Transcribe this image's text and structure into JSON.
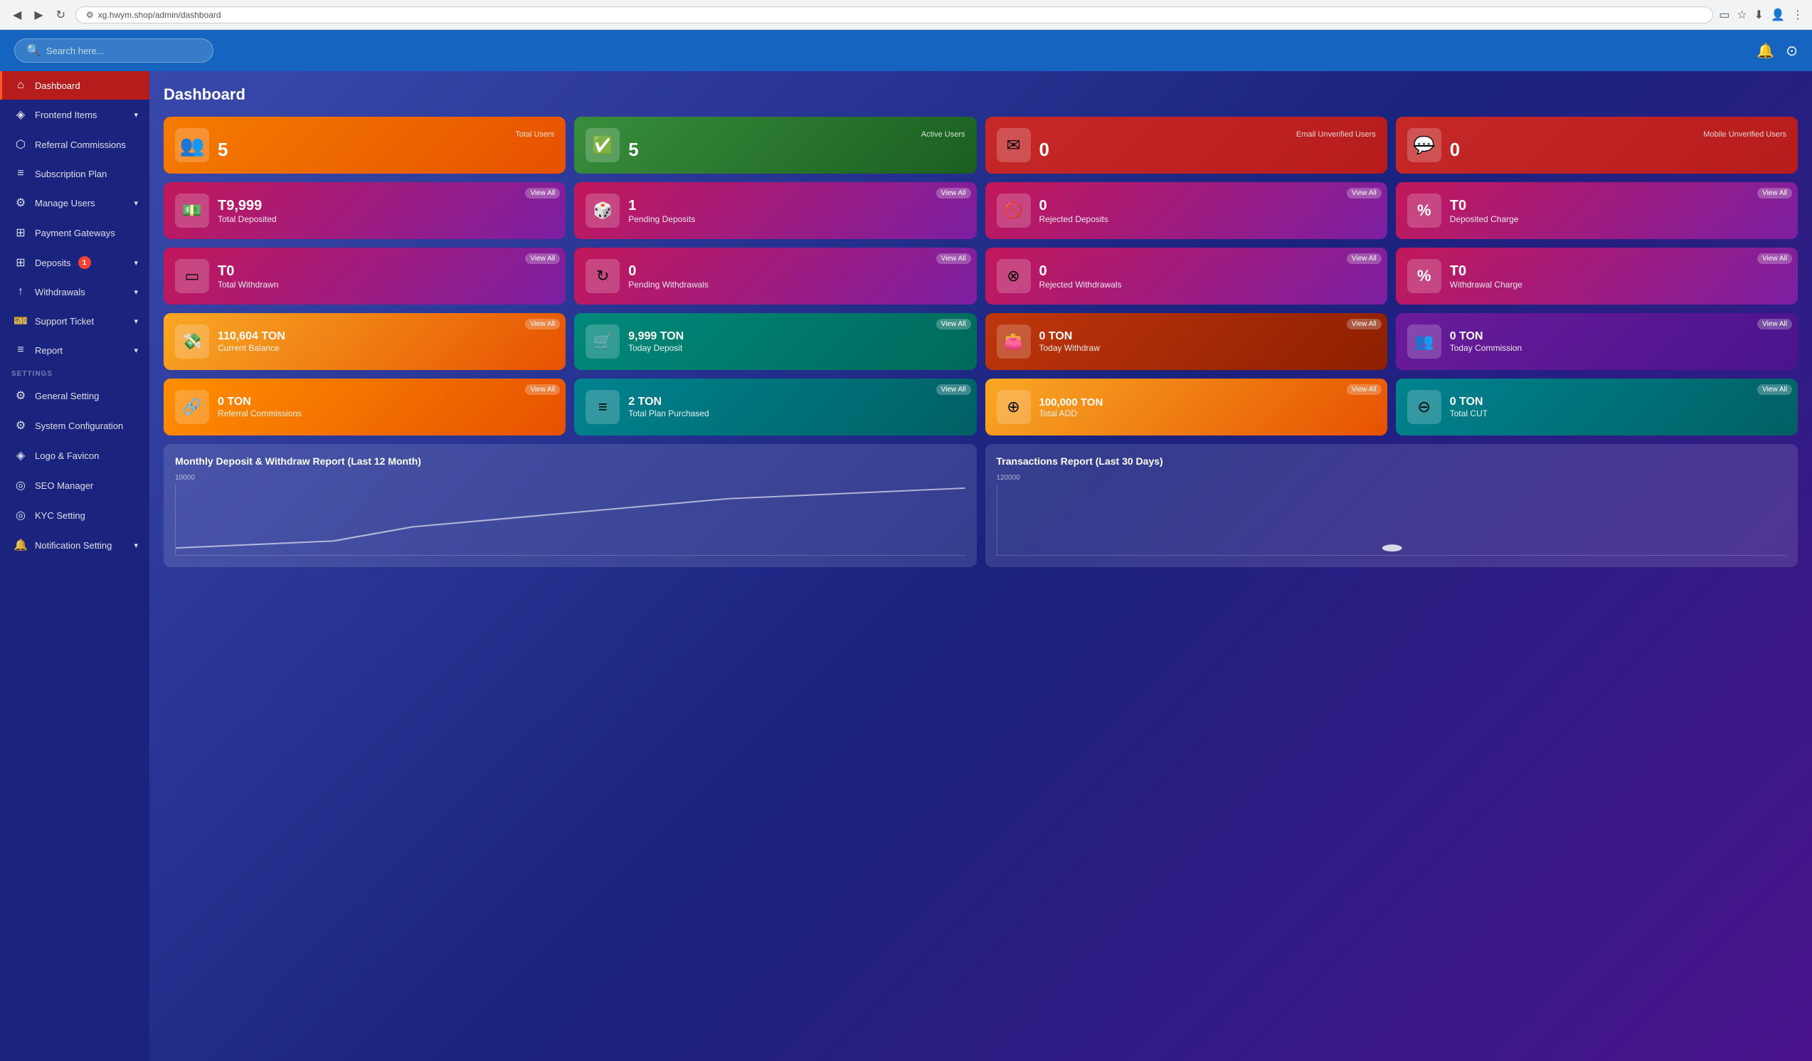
{
  "browser": {
    "url": "xg.hwym.shop/admin/dashboard",
    "back_icon": "◀",
    "forward_icon": "▶",
    "refresh_icon": "↻"
  },
  "header": {
    "search_placeholder": "Search here...",
    "bell_icon": "🔔",
    "settings_icon": "⚙"
  },
  "sidebar": {
    "items": [
      {
        "id": "dashboard",
        "label": "Dashboard",
        "icon": "⌂",
        "active": true
      },
      {
        "id": "frontend-items",
        "label": "Frontend Items",
        "icon": "◈",
        "has_arrow": true
      },
      {
        "id": "referral-commissions",
        "label": "Referral Commissions",
        "icon": "⬡",
        "has_arrow": false
      },
      {
        "id": "subscription-plan",
        "label": "Subscription Plan",
        "icon": "≡",
        "has_arrow": false
      },
      {
        "id": "manage-users",
        "label": "Manage Users",
        "icon": "⚙",
        "has_arrow": true
      },
      {
        "id": "payment-gateways",
        "label": "Payment Gateways",
        "icon": "⊞",
        "has_arrow": false
      },
      {
        "id": "deposits",
        "label": "Deposits",
        "icon": "⊞",
        "badge": "1",
        "has_arrow": true
      },
      {
        "id": "withdrawals",
        "label": "Withdrawals",
        "icon": "↑",
        "has_arrow": true
      },
      {
        "id": "support-ticket",
        "label": "Support Ticket",
        "icon": "🎫",
        "has_arrow": true
      },
      {
        "id": "report",
        "label": "Report",
        "icon": "≡",
        "has_arrow": true
      }
    ],
    "settings_section": "SETTINGS",
    "settings_items": [
      {
        "id": "general-setting",
        "label": "General Setting",
        "icon": "⚙"
      },
      {
        "id": "system-configuration",
        "label": "System Configuration",
        "icon": "⚙"
      },
      {
        "id": "logo-favicon",
        "label": "Logo & Favicon",
        "icon": "◈"
      },
      {
        "id": "seo-manager",
        "label": "SEO Manager",
        "icon": "◎"
      },
      {
        "id": "kyc-setting",
        "label": "KYC Setting",
        "icon": "◎"
      },
      {
        "id": "notification-setting",
        "label": "Notification Setting",
        "icon": "🔔",
        "has_arrow": true
      }
    ]
  },
  "page_title": "Dashboard",
  "stats_row1": [
    {
      "id": "total-users",
      "label": "Total Users",
      "value": "5",
      "name": "",
      "color": "card-orange",
      "icon": "👥",
      "view_all": false
    },
    {
      "id": "active-users",
      "label": "Active Users",
      "value": "5",
      "name": "",
      "color": "card-green",
      "icon": "✅",
      "view_all": false
    },
    {
      "id": "email-unverified",
      "label": "Email Unverified Users",
      "value": "0",
      "name": "",
      "color": "card-red",
      "icon": "✉",
      "view_all": false
    },
    {
      "id": "mobile-unverified",
      "label": "Mobile Unverified Users",
      "value": "0",
      "name": "",
      "color": "card-red",
      "icon": "💬",
      "view_all": false
    }
  ],
  "stats_row2": [
    {
      "id": "total-deposited",
      "label": "View All",
      "value": "T9,999",
      "name": "Total Deposited",
      "color": "card-pink-red",
      "icon": "💵",
      "view_all": true
    },
    {
      "id": "pending-deposits",
      "label": "View All",
      "value": "1",
      "name": "Pending Deposits",
      "color": "card-pink-red",
      "icon": "🎲",
      "view_all": true
    },
    {
      "id": "rejected-deposits",
      "label": "View All",
      "value": "0",
      "name": "Rejected Deposits",
      "color": "card-pink-red",
      "icon": "🚫",
      "view_all": true
    },
    {
      "id": "deposited-charge",
      "label": "View All",
      "value": "T0",
      "name": "Deposited Charge",
      "color": "card-pink-red",
      "icon": "%",
      "view_all": true
    }
  ],
  "stats_row3": [
    {
      "id": "total-withdrawn",
      "label": "View All",
      "value": "T0",
      "name": "Total Withdrawn",
      "color": "card-pink-red",
      "icon": "▭",
      "view_all": true
    },
    {
      "id": "pending-withdrawals",
      "label": "View All",
      "value": "0",
      "name": "Pending Withdrawals",
      "color": "card-pink-red",
      "icon": "↻",
      "view_all": true
    },
    {
      "id": "rejected-withdrawals",
      "label": "View All",
      "value": "0",
      "name": "Rejected Withdrawals",
      "color": "card-pink-red",
      "icon": "⊗",
      "view_all": true
    },
    {
      "id": "withdrawal-charge",
      "label": "View All",
      "value": "T0",
      "name": "Withdrawal Charge",
      "color": "card-pink-red",
      "icon": "%",
      "view_all": true
    }
  ],
  "stats_row4": [
    {
      "id": "current-balance",
      "label": "View All",
      "value": "110,604 TON",
      "name": "Current Balance",
      "color": "card-gold",
      "icon": "💸",
      "view_all": true
    },
    {
      "id": "today-deposit",
      "label": "View All",
      "value": "9,999 TON",
      "name": "Today Deposit",
      "color": "card-dark-teal",
      "icon": "🛒",
      "view_all": true
    },
    {
      "id": "today-withdraw",
      "label": "View All",
      "value": "0 TON",
      "name": "Today Withdraw",
      "color": "card-deep-orange",
      "icon": "👛",
      "view_all": true
    },
    {
      "id": "today-commission",
      "label": "View All",
      "value": "0 TON",
      "name": "Today Commission",
      "color": "card-purple",
      "icon": "👥",
      "view_all": true
    }
  ],
  "stats_row5": [
    {
      "id": "referral-commissions",
      "label": "View All",
      "value": "0 TON",
      "name": "Referral Commissions",
      "color": "card-amber",
      "icon": "🔗",
      "view_all": true
    },
    {
      "id": "total-plan-purchased",
      "label": "View All",
      "value": "2 TON",
      "name": "Total Plan Purchased",
      "color": "card-blue-green",
      "icon": "≡",
      "view_all": true
    },
    {
      "id": "total-add",
      "label": "View All",
      "value": "100,000 TON",
      "name": "Total ADD",
      "color": "card-gold",
      "icon": "⊕",
      "view_all": true
    },
    {
      "id": "total-cut",
      "label": "View All",
      "value": "0 TON",
      "name": "Total CUT",
      "color": "card-blue-green",
      "icon": "⊖",
      "view_all": true
    }
  ],
  "charts": [
    {
      "id": "monthly-report",
      "title": "Monthly Deposit & Withdraw Report (Last 12 Month)",
      "y_label": "10000"
    },
    {
      "id": "transactions-report",
      "title": "Transactions Report (Last 30 Days)",
      "y_label": "120000"
    }
  ]
}
